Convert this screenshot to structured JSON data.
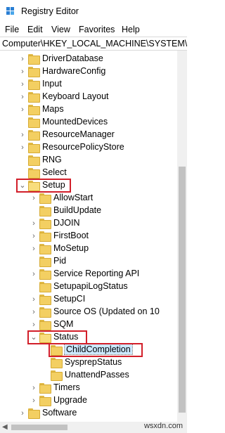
{
  "window": {
    "title": "Registry Editor"
  },
  "menu": [
    "File",
    "Edit",
    "View",
    "Favorites",
    "Help"
  ],
  "address": "Computer\\HKEY_LOCAL_MACHINE\\SYSTEM\\Setup\\Status\\ChildCompletion",
  "tree": [
    {
      "label": "DriverDatabase",
      "expander": "collapsed",
      "level": 2
    },
    {
      "label": "HardwareConfig",
      "expander": "collapsed",
      "level": 2
    },
    {
      "label": "Input",
      "expander": "collapsed",
      "level": 2
    },
    {
      "label": "Keyboard Layout",
      "expander": "collapsed",
      "level": 2
    },
    {
      "label": "Maps",
      "expander": "collapsed",
      "level": 2
    },
    {
      "label": "MountedDevices",
      "expander": "none",
      "level": 2
    },
    {
      "label": "ResourceManager",
      "expander": "collapsed",
      "level": 2
    },
    {
      "label": "ResourcePolicyStore",
      "expander": "collapsed",
      "level": 2
    },
    {
      "label": "RNG",
      "expander": "none",
      "level": 2
    },
    {
      "label": "Select",
      "expander": "none",
      "level": 2
    },
    {
      "label": "Setup",
      "expander": "expanded",
      "level": 2,
      "highlighted": true
    },
    {
      "label": "AllowStart",
      "expander": "collapsed",
      "level": 3
    },
    {
      "label": "BuildUpdate",
      "expander": "none",
      "level": 3
    },
    {
      "label": "DJOIN",
      "expander": "collapsed",
      "level": 3
    },
    {
      "label": "FirstBoot",
      "expander": "collapsed",
      "level": 3
    },
    {
      "label": "MoSetup",
      "expander": "collapsed",
      "level": 3
    },
    {
      "label": "Pid",
      "expander": "none",
      "level": 3
    },
    {
      "label": "Service Reporting API",
      "expander": "collapsed",
      "level": 3
    },
    {
      "label": "SetupapiLogStatus",
      "expander": "none",
      "level": 3
    },
    {
      "label": "SetupCI",
      "expander": "collapsed",
      "level": 3
    },
    {
      "label": "Source OS (Updated on 10",
      "expander": "collapsed",
      "level": 3
    },
    {
      "label": "SQM",
      "expander": "collapsed",
      "level": 3
    },
    {
      "label": "Status",
      "expander": "expanded",
      "level": 3,
      "highlighted": true
    },
    {
      "label": "ChildCompletion",
      "expander": "none",
      "level": 4,
      "selected": true,
      "highlighted": true
    },
    {
      "label": "SysprepStatus",
      "expander": "none",
      "level": 4
    },
    {
      "label": "UnattendPasses",
      "expander": "none",
      "level": 4
    },
    {
      "label": "Timers",
      "expander": "collapsed",
      "level": 3
    },
    {
      "label": "Upgrade",
      "expander": "collapsed",
      "level": 3
    },
    {
      "label": "Software",
      "expander": "collapsed",
      "level": 2
    }
  ],
  "colors": {
    "highlight_box": "#d21f2a",
    "selection": "#cce8ff",
    "folder": "#f3cf62"
  },
  "watermark": "wsxdn.com"
}
